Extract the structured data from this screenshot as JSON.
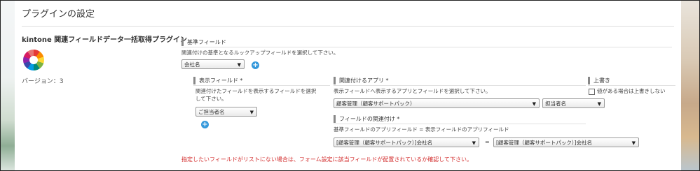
{
  "page": {
    "title": "プラグインの設定"
  },
  "plugin": {
    "name": "kintone 関連フィールドデータ一括取得プラグイン",
    "version": "バージョン：3"
  },
  "base_field": {
    "label": "基準フィールド",
    "hint": "関連付けの基準となるルックアップフィールドを選択して下さい。",
    "selected": "会社名"
  },
  "display_field": {
    "label": "表示フィールド *",
    "hint_line1": "関連付けたフィールドを表示するフィールドを選択",
    "hint_line2": "して下さい。",
    "selected": "ご担当者名"
  },
  "related_app": {
    "label": "関連付けるアプリ *",
    "hint": "表示フィールドへ表示するアプリとフィールドを選択して下さい。",
    "app_selected": "顧客管理（顧客サポートパック）",
    "field_selected": "担当者名"
  },
  "overwrite": {
    "label": "上書き",
    "checkbox_label": "値がある場合は上書きしない"
  },
  "field_relation": {
    "label": "フィールドの関連付け *",
    "hint": "基準フィールドのアプリフィールド = 表示フィールドのアプリフィールド",
    "left_selected": "[顧客管理（顧客サポートパック）]会社名",
    "equals": "=",
    "right_selected": "[顧客管理（顧客サポートパック）]会社名"
  },
  "footer": {
    "error": "指定したいフィールドがリストにない場合は、フォーム設定に該当フィールドが配置されているか確認して下さい。"
  },
  "icons": {
    "add": "plus-circle-icon",
    "dropdown": "chevron-down-icon",
    "logo": "color-wheel-icon"
  },
  "colors": {
    "accent": "#3498db",
    "error": "#d32f2f"
  }
}
